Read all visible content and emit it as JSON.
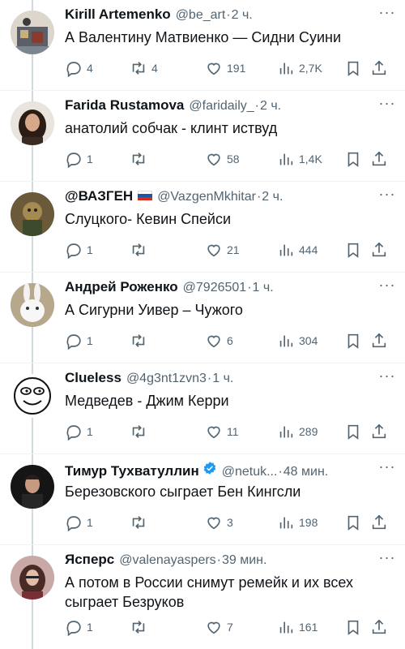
{
  "colors": {
    "secondary_text": "#536471",
    "primary_text": "#0f1419",
    "verified": "#1d9bf0",
    "thread_line": "#cfd9de"
  },
  "tweets": [
    {
      "name": "Kirill Artemenko",
      "handle": "@be_art",
      "dot": "·",
      "time": "2 ч.",
      "text": "А Валентину Матвиенко — Сидни Суини",
      "replies": "4",
      "retweets": "4",
      "likes": "191",
      "views": "2,7K",
      "avatar_icon": "avatar-kirill"
    },
    {
      "name": "Farida Rustamova",
      "handle": "@faridaily_",
      "dot": "·",
      "time": "2 ч.",
      "text": "анатолий собчак - клинт иствуд",
      "replies": "1",
      "retweets": "",
      "likes": "58",
      "views": "1,4K",
      "avatar_icon": "avatar-farida"
    },
    {
      "name": "@ВАЗГЕН",
      "flag": "russia-flag-icon",
      "handle": "@VazgenMkhitar",
      "dot": "·",
      "time": "2 ч.",
      "text": "Слуцкого- Кевин Спейси",
      "replies": "1",
      "retweets": "",
      "likes": "21",
      "views": "444",
      "avatar_icon": "avatar-vazgen"
    },
    {
      "name": "Андрей Роженко",
      "handle": "@7926501",
      "dot": "·",
      "time": "1 ч.",
      "text": "А Сигурни Уивер – Чужого",
      "replies": "1",
      "retweets": "",
      "likes": "6",
      "views": "304",
      "avatar_icon": "avatar-rabbit"
    },
    {
      "name": "Clueless",
      "handle": "@4g3nt1zvn3",
      "dot": "·",
      "time": "1 ч.",
      "text": "Медведев - Джим Керри",
      "replies": "1",
      "retweets": "",
      "likes": "11",
      "views": "289",
      "avatar_icon": "avatar-clueless"
    },
    {
      "name": "Тимур Тухватуллин",
      "verified": "verified-badge-icon",
      "handle": "@netuk...",
      "dot": "·",
      "time": "48 мин.",
      "text": "Березовского сыграет Бен Кингсли",
      "replies": "1",
      "retweets": "",
      "likes": "3",
      "views": "198",
      "avatar_icon": "avatar-timur"
    },
    {
      "name": "Ясперс",
      "handle": "@valenayaspers",
      "dot": "·",
      "time": "39 мин.",
      "text": "А потом в России снимут ремейк и их всех сыграет Безруков",
      "replies": "1",
      "retweets": "",
      "likes": "7",
      "views": "161",
      "avatar_icon": "avatar-yaspers"
    }
  ],
  "more_label": "···"
}
